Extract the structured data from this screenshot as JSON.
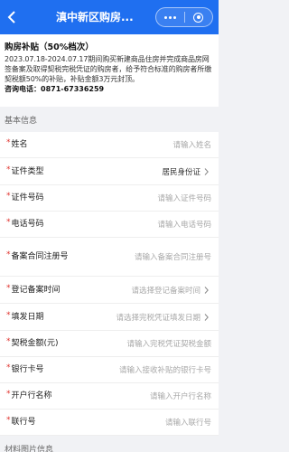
{
  "header": {
    "title": "滇中新区购房...",
    "back_icon": "chevron-left-icon",
    "more_icon": "more-dots-icon",
    "close_icon": "target-circle-icon",
    "color": "#1f6ff0"
  },
  "notice": {
    "title": "购房补贴（50%档次）",
    "body": "2023.07.18-2024.07.17期间购买新建商品住房并完成商品房网签备案及取得契税完税凭证的购房者，给予符合标准的购房者所缴契税额50%的补贴，补贴金额3万元封顶。",
    "contact": "咨询电话：0871-67336259"
  },
  "sections": {
    "basic": "基本信息",
    "materials": "材料图片信息"
  },
  "form": {
    "fields": [
      {
        "label": "姓名",
        "value": "请输入姓名",
        "required": true,
        "arrow": false
      },
      {
        "label": "证件类型",
        "value": "居民身份证",
        "required": true,
        "arrow": true,
        "filled": true
      },
      {
        "label": "证件号码",
        "value": "请输入证件号码",
        "required": true,
        "arrow": false
      },
      {
        "label": "电话号码",
        "value": "请输入电话号码",
        "required": true,
        "arrow": false
      },
      {
        "label": "备案合同注册号",
        "value": "请输入备案合同注册号",
        "required": true,
        "arrow": false
      },
      {
        "label": "登记备案时间",
        "value": "请选择登记备案时间",
        "required": true,
        "arrow": true
      },
      {
        "label": "填发日期",
        "value": "请选择完税凭证填发日期",
        "required": true,
        "arrow": true
      },
      {
        "label": "契税金额(元)",
        "value": "请输入完税凭证契税金额",
        "required": true,
        "arrow": false
      },
      {
        "label": "银行卡号",
        "value": "请输入接收补贴的银行卡号",
        "required": true,
        "arrow": false
      },
      {
        "label": "开户行名称",
        "value": "请输入开户行名称",
        "required": true,
        "arrow": false
      },
      {
        "label": "联行号",
        "value": "请输入联行号",
        "required": true,
        "arrow": false
      }
    ]
  },
  "colors": {
    "required_mark": "#e0322d",
    "placeholder": "#a8a8a8",
    "page_bg": "#f1f2f5"
  }
}
